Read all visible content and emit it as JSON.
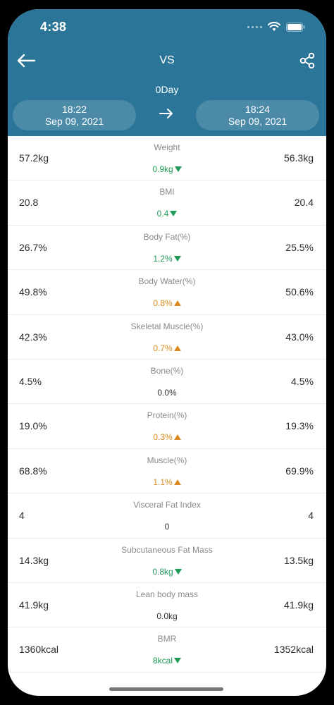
{
  "status": {
    "time": "4:38"
  },
  "header": {
    "title": "VS",
    "duration": "0Day",
    "from": {
      "time": "18:22",
      "date": "Sep 09, 2021"
    },
    "to": {
      "time": "18:24",
      "date": "Sep 09, 2021"
    }
  },
  "colors": {
    "header": "#2a7598",
    "decrease": "#1f9a57",
    "increase": "#d98a1c"
  },
  "metrics": [
    {
      "label": "Weight",
      "left": "57.2kg",
      "right": "56.3kg",
      "diff": "0.9kg",
      "trend": "down"
    },
    {
      "label": "BMI",
      "left": "20.8",
      "right": "20.4",
      "diff": "0.4",
      "trend": "down"
    },
    {
      "label": "Body Fat(%)",
      "left": "26.7%",
      "right": "25.5%",
      "diff": "1.2%",
      "trend": "down"
    },
    {
      "label": "Body Water(%)",
      "left": "49.8%",
      "right": "50.6%",
      "diff": "0.8%",
      "trend": "up"
    },
    {
      "label": "Skeletal Muscle(%)",
      "left": "42.3%",
      "right": "43.0%",
      "diff": "0.7%",
      "trend": "up"
    },
    {
      "label": "Bone(%)",
      "left": "4.5%",
      "right": "4.5%",
      "diff": "0.0%",
      "trend": "none"
    },
    {
      "label": "Protein(%)",
      "left": "19.0%",
      "right": "19.3%",
      "diff": "0.3%",
      "trend": "up"
    },
    {
      "label": "Muscle(%)",
      "left": "68.8%",
      "right": "69.9%",
      "diff": "1.1%",
      "trend": "up"
    },
    {
      "label": "Visceral Fat Index",
      "left": "4",
      "right": "4",
      "diff": "0",
      "trend": "none"
    },
    {
      "label": "Subcutaneous Fat Mass",
      "left": "14.3kg",
      "right": "13.5kg",
      "diff": "0.8kg",
      "trend": "down"
    },
    {
      "label": "Lean body mass",
      "left": "41.9kg",
      "right": "41.9kg",
      "diff": "0.0kg",
      "trend": "none"
    },
    {
      "label": "BMR",
      "left": "1360kcal",
      "right": "1352kcal",
      "diff": "8kcal",
      "trend": "down"
    }
  ]
}
